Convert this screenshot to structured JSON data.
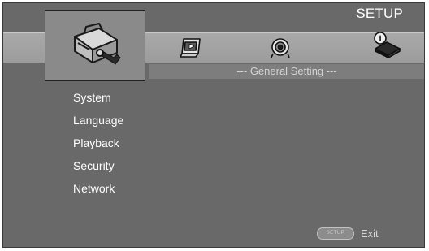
{
  "header": {
    "title": "SETUP"
  },
  "tabs": [
    {
      "icon": "toolbox-icon",
      "selected": true
    },
    {
      "icon": "display-icon",
      "selected": false
    },
    {
      "icon": "audio-icon",
      "selected": false
    },
    {
      "icon": "information-icon",
      "selected": false
    }
  ],
  "category": {
    "label": "--- General Setting ---"
  },
  "menu": {
    "items": [
      {
        "label": "System"
      },
      {
        "label": "Language"
      },
      {
        "label": "Playback"
      },
      {
        "label": "Security"
      },
      {
        "label": "Network"
      }
    ]
  },
  "footer": {
    "button_label": "SETUP",
    "exit_label": "Exit"
  }
}
